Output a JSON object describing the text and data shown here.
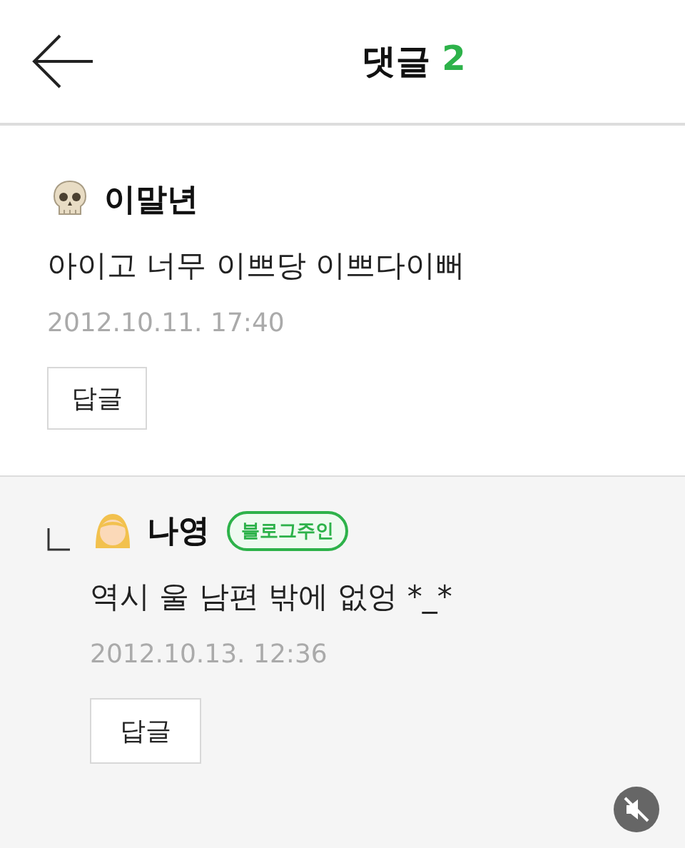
{
  "header": {
    "title": "댓글",
    "count": "2"
  },
  "comments": [
    {
      "kind": "comment",
      "avatar": {
        "kind": "skull"
      },
      "author": "이말년",
      "text": "아이고 너무 이쁘당 이쁘다이뻐",
      "date": "2012.10.11. 17:40",
      "reply_button": "답글"
    },
    {
      "kind": "reply",
      "avatar": {
        "kind": "girl"
      },
      "author": "나영",
      "badge": "블로그주인",
      "text": "역시 울 남편 밖에 없엉 *_*",
      "date": "2012.10.13. 12:36",
      "reply_button": "답글"
    }
  ],
  "video_overlay": {
    "muted": true
  }
}
